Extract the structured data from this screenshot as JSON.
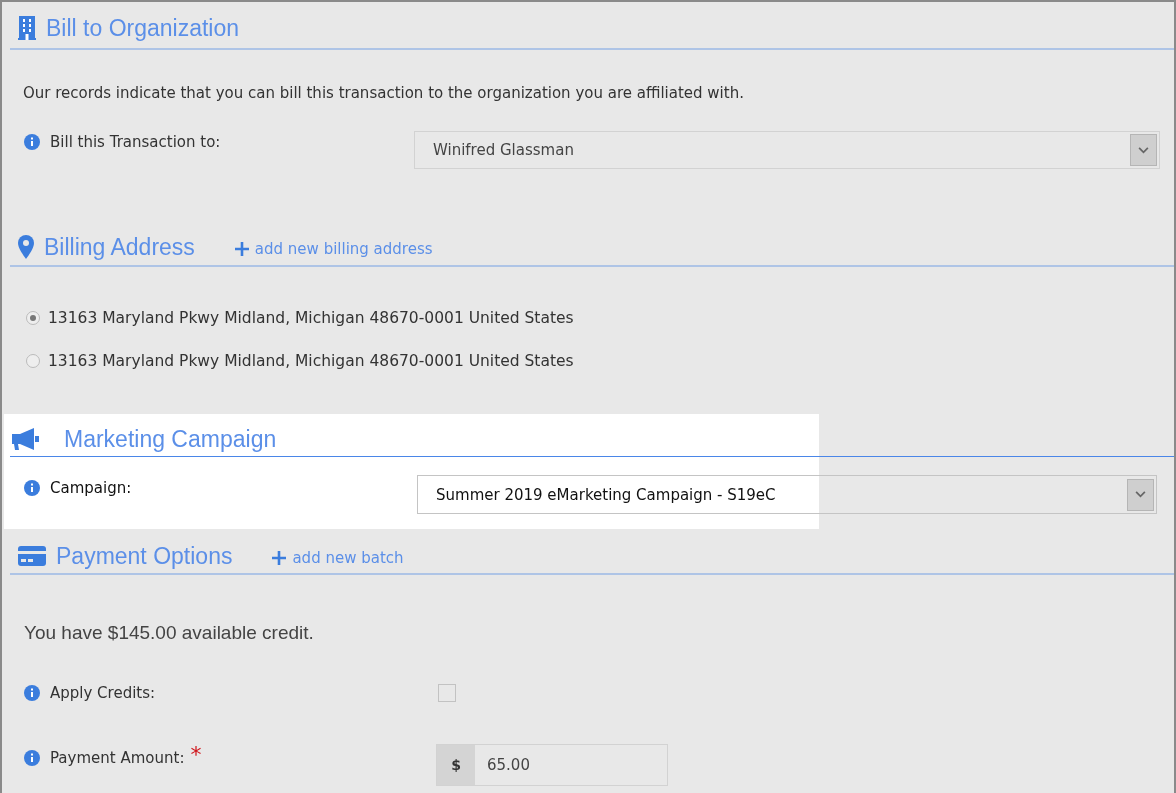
{
  "bill_to_organization": {
    "title": "Bill to Organization",
    "intro": "Our records indicate that you can bill this transaction to the organization you are affiliated with.",
    "field": {
      "label": "Bill this Transaction to:",
      "value": "Winifred Glassman"
    }
  },
  "billing_address": {
    "title": "Billing Address",
    "add_link": "add new billing address",
    "addresses": [
      {
        "text": "13163 Maryland Pkwy Midland, Michigan 48670-0001 United States",
        "selected": true
      },
      {
        "text": "13163 Maryland Pkwy Midland, Michigan 48670-0001 United States",
        "selected": false
      }
    ]
  },
  "marketing_campaign": {
    "title": "Marketing Campaign",
    "highlighted": true,
    "field": {
      "label": "Campaign:",
      "value": "Summer 2019 eMarketing Campaign - S19eC"
    }
  },
  "payment_options": {
    "title": "Payment Options",
    "add_link": "add new batch",
    "credit_text": "You have $145.00 available credit.",
    "apply_credits": {
      "label": "Apply Credits:",
      "checked": false
    },
    "payment_amount": {
      "label": "Payment Amount:",
      "required": true,
      "required_mark": "*",
      "currency": "$",
      "value": "65.00"
    }
  }
}
